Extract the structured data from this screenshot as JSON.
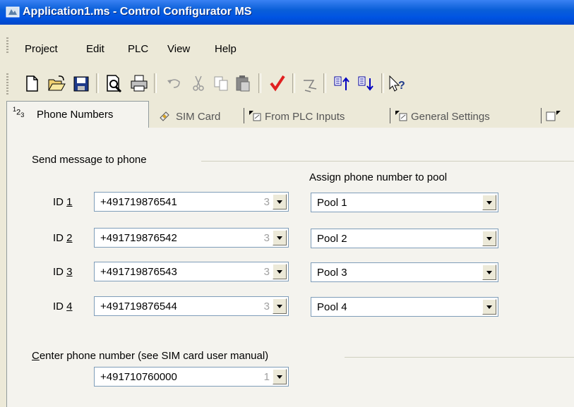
{
  "window": {
    "title": "Application1.ms - Control Configurator MS"
  },
  "menu": {
    "items": [
      {
        "label": "Project"
      },
      {
        "label": "Edit"
      },
      {
        "label": "PLC"
      },
      {
        "label": "View"
      },
      {
        "label": "Help"
      }
    ]
  },
  "toolbar": {
    "icons": [
      "new-file-icon",
      "open-folder-icon",
      "save-icon",
      "print-preview-icon",
      "print-icon",
      "undo-icon",
      "cut-icon",
      "copy-icon",
      "paste-icon",
      "check-icon",
      "validate-icon",
      "upload-icon",
      "download-icon",
      "help-pointer-icon"
    ]
  },
  "tabs": [
    {
      "label": "Phone Numbers",
      "prefix": "1",
      "sub": "2",
      "sub2": "3",
      "active": true
    },
    {
      "label": "SIM Card",
      "active": false
    },
    {
      "label": "From PLC Inputs",
      "active": false
    },
    {
      "label": "General Settings",
      "active": false
    }
  ],
  "send_group": {
    "label": "Send message to phone",
    "pool_header": "Assign phone number to pool",
    "rows": [
      {
        "id_prefix": "ID ",
        "id_num": "1",
        "phone": "+491719876541",
        "count": "3",
        "pool": "Pool 1"
      },
      {
        "id_prefix": "ID ",
        "id_num": "2",
        "phone": "+491719876542",
        "count": "3",
        "pool": "Pool 2"
      },
      {
        "id_prefix": "ID ",
        "id_num": "3",
        "phone": "+491719876543",
        "count": "3",
        "pool": "Pool 3"
      },
      {
        "id_prefix": "ID ",
        "id_num": "4",
        "phone": "+491719876544",
        "count": "3",
        "pool": "Pool 4"
      }
    ]
  },
  "center_group": {
    "label_first": "C",
    "label_rest": "enter phone number (see SIM card user manual)",
    "phone": "+491710760000",
    "count": "1"
  }
}
